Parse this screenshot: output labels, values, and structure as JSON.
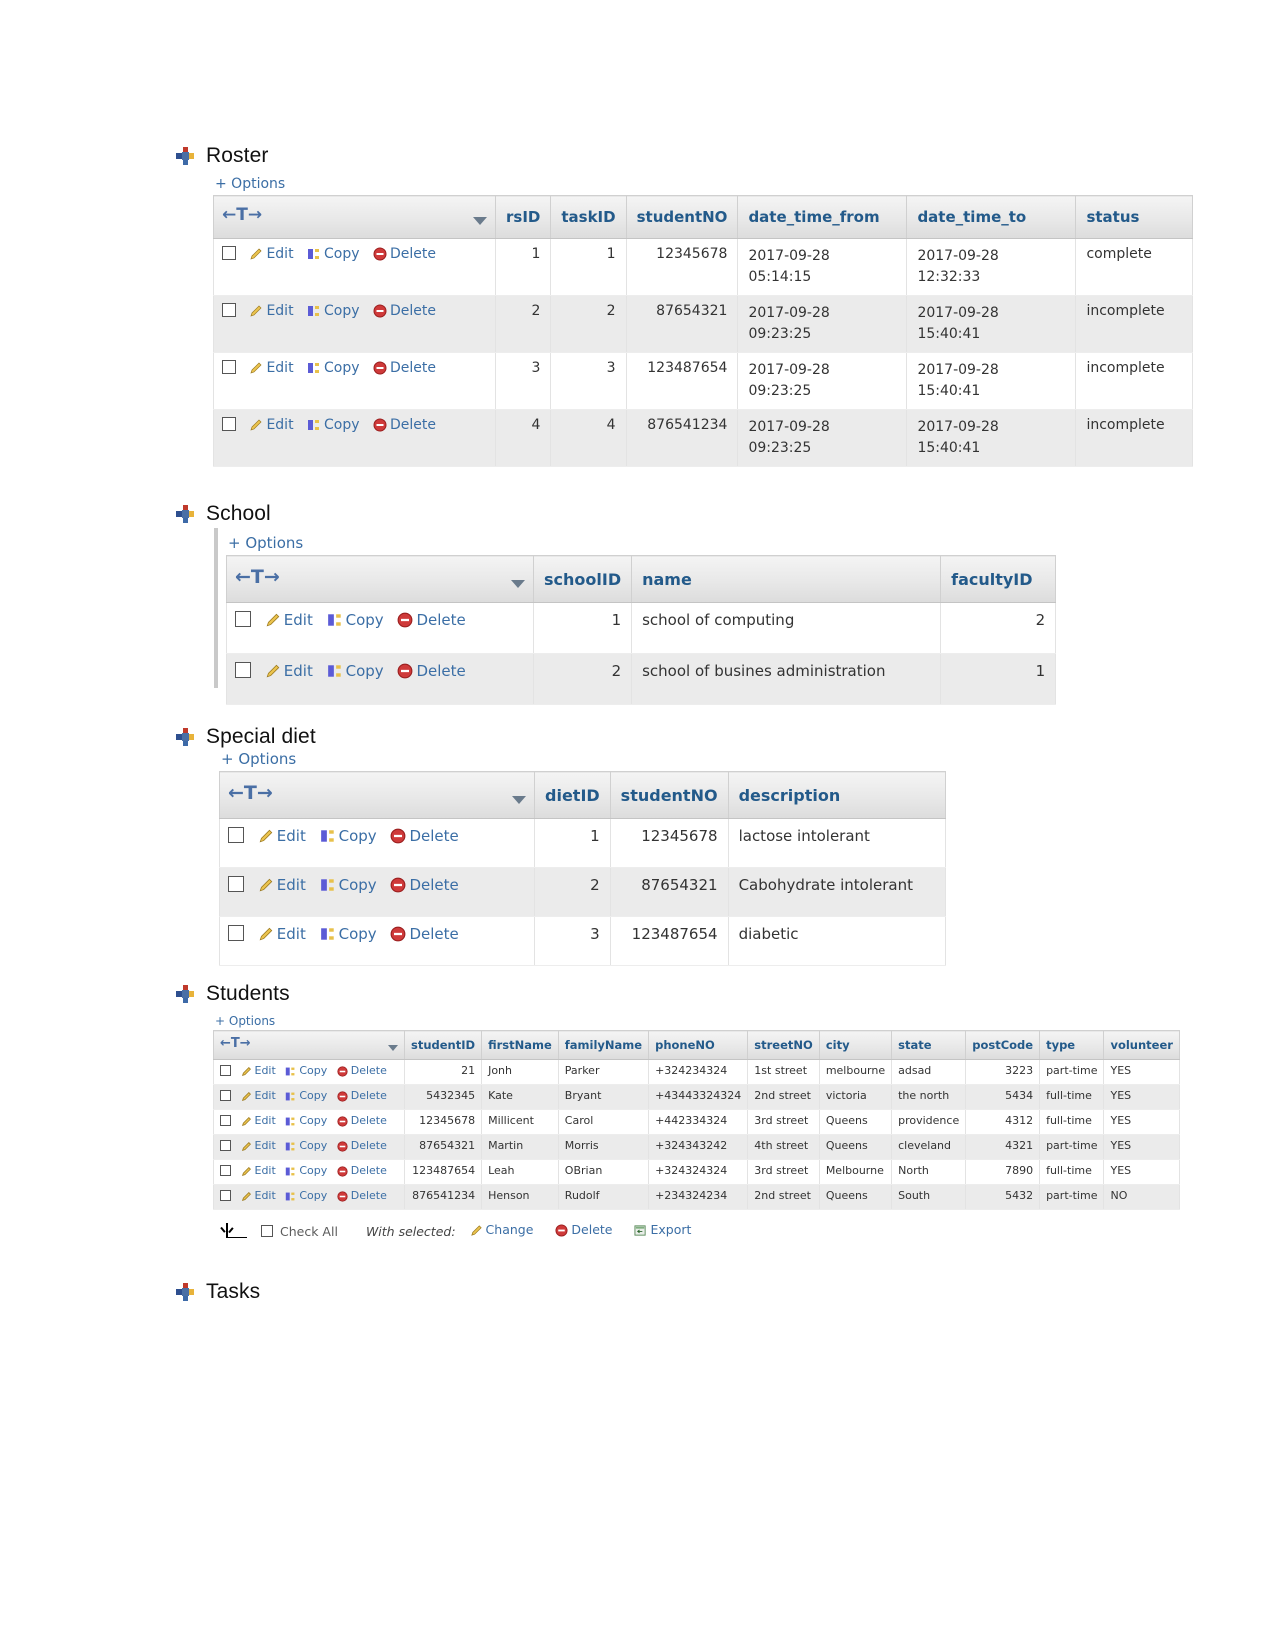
{
  "document": {
    "sections": [
      {
        "id": "roster",
        "heading": "Roster",
        "options_label": "+ Options",
        "sort_control": "←T→",
        "columns": [
          "rsID",
          "taskID",
          "studentNO",
          "date_time_from",
          "date_time_to",
          "status"
        ],
        "row_actions": {
          "edit": "Edit",
          "copy": "Copy",
          "delete": "Delete"
        },
        "rows": [
          {
            "rsID": "1",
            "taskID": "1",
            "studentNO": "12345678",
            "date_time_from": "2017-09-28 05:14:15",
            "date_time_to": "2017-09-28 12:32:33",
            "status": "complete"
          },
          {
            "rsID": "2",
            "taskID": "2",
            "studentNO": "87654321",
            "date_time_from": "2017-09-28 09:23:25",
            "date_time_to": "2017-09-28 15:40:41",
            "status": "incomplete"
          },
          {
            "rsID": "3",
            "taskID": "3",
            "studentNO": "123487654",
            "date_time_from": "2017-09-28 09:23:25",
            "date_time_to": "2017-09-28 15:40:41",
            "status": "incomplete"
          },
          {
            "rsID": "4",
            "taskID": "4",
            "studentNO": "876541234",
            "date_time_from": "2017-09-28 09:23:25",
            "date_time_to": "2017-09-28 15:40:41",
            "status": "incomplete"
          }
        ]
      },
      {
        "id": "school",
        "heading": "School",
        "options_label": "+ Options",
        "sort_control": "←T→",
        "columns": [
          "schoolID",
          "name",
          "facultyID"
        ],
        "row_actions": {
          "edit": "Edit",
          "copy": "Copy",
          "delete": "Delete"
        },
        "rows": [
          {
            "schoolID": "1",
            "name": "school of computing",
            "facultyID": "2"
          },
          {
            "schoolID": "2",
            "name": "school of busines administration",
            "facultyID": "1"
          }
        ]
      },
      {
        "id": "special-diet",
        "heading": "Special diet",
        "options_label": "+ Options",
        "sort_control": "←T→",
        "columns": [
          "dietID",
          "studentNO",
          "description"
        ],
        "row_actions": {
          "edit": "Edit",
          "copy": "Copy",
          "delete": "Delete"
        },
        "rows": [
          {
            "dietID": "1",
            "studentNO": "12345678",
            "description": "lactose intolerant"
          },
          {
            "dietID": "2",
            "studentNO": "87654321",
            "description": "Cabohydrate intolerant"
          },
          {
            "dietID": "3",
            "studentNO": "123487654",
            "description": "diabetic"
          }
        ]
      },
      {
        "id": "students",
        "heading": "Students",
        "options_label": "+ Options",
        "sort_control": "←T→",
        "columns": [
          "studentID",
          "firstName",
          "familyName",
          "phoneNO",
          "streetNO",
          "city",
          "state",
          "postCode",
          "type",
          "volunteer"
        ],
        "row_actions": {
          "edit": "Edit",
          "copy": "Copy",
          "delete": "Delete"
        },
        "rows": [
          {
            "studentID": "21",
            "firstName": "Jonh",
            "familyName": "Parker",
            "phoneNO": "+324234324",
            "streetNO": "1st street",
            "city": "melbourne",
            "state": "adsad",
            "postCode": "3223",
            "type": "part-time",
            "volunteer": "YES"
          },
          {
            "studentID": "5432345",
            "firstName": "Kate",
            "familyName": "Bryant",
            "phoneNO": "+43443324324",
            "streetNO": "2nd street",
            "city": "victoria",
            "state": "the north",
            "postCode": "5434",
            "type": "full-time",
            "volunteer": "YES"
          },
          {
            "studentID": "12345678",
            "firstName": "Millicent",
            "familyName": "Carol",
            "phoneNO": "+442334324",
            "streetNO": "3rd street",
            "city": "Queens",
            "state": "providence",
            "postCode": "4312",
            "type": "full-time",
            "volunteer": "YES"
          },
          {
            "studentID": "87654321",
            "firstName": "Martin",
            "familyName": "Morris",
            "phoneNO": "+324343242",
            "streetNO": "4th street",
            "city": "Queens",
            "state": "cleveland",
            "postCode": "4321",
            "type": "part-time",
            "volunteer": "YES"
          },
          {
            "studentID": "123487654",
            "firstName": "Leah",
            "familyName": "OBrian",
            "phoneNO": "+324324324",
            "streetNO": "3rd street",
            "city": "Melbourne",
            "state": "North",
            "postCode": "7890",
            "type": "full-time",
            "volunteer": "YES"
          },
          {
            "studentID": "876541234",
            "firstName": "Henson",
            "familyName": "Rudolf",
            "phoneNO": "+234324234",
            "streetNO": "2nd street",
            "city": "Queens",
            "state": "South",
            "postCode": "5432",
            "type": "part-time",
            "volunteer": "NO"
          }
        ],
        "footer": {
          "check_all": "Check All",
          "with_selected": "With selected:",
          "change": "Change",
          "delete": "Delete",
          "export": "Export"
        }
      },
      {
        "id": "tasks",
        "heading": "Tasks"
      }
    ]
  },
  "colors": {
    "link": "#3b6ea5",
    "header_text": "#235a8a",
    "alt_row": "#ebebeb",
    "delete_red": "#cc2b2b",
    "pencil_yellow": "#e8c14a"
  }
}
